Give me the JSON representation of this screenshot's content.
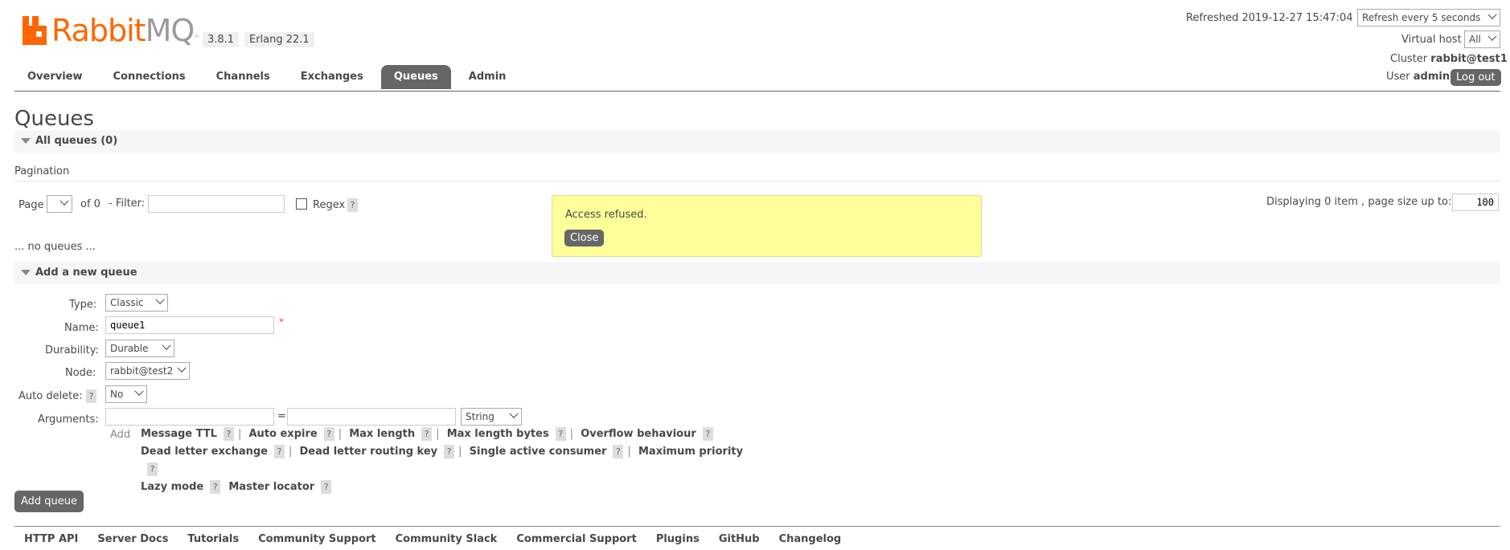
{
  "header": {
    "brand_main": "Rabbit",
    "brand_mq": "MQ",
    "brand_tm": "™",
    "version": "3.8.1",
    "erlang": "Erlang 22.1",
    "refreshed": "Refreshed 2019-12-27 15:47:04",
    "refresh_select": "Refresh every 5 seconds",
    "vhost_label": "Virtual host",
    "vhost_select": "All",
    "cluster_label": "Cluster",
    "cluster_value": "rabbit@test1",
    "user_label": "User",
    "user_value": "admin",
    "logout": "Log out"
  },
  "tabs": [
    "Overview",
    "Connections",
    "Channels",
    "Exchanges",
    "Queues",
    "Admin"
  ],
  "page_title": "Queues",
  "all_queues": {
    "header": "All queues (0)",
    "pagination_label": "Pagination",
    "page_label": "Page",
    "of_label": "of 0",
    "filter_label": "- Filter:",
    "regex_label": "Regex",
    "help": "?",
    "displaying": "Displaying 0 item , page size up to:",
    "page_size": "100",
    "empty": "... no queues ..."
  },
  "alert": {
    "message": "Access refused.",
    "close": "Close"
  },
  "add_queue": {
    "header": "Add a new queue",
    "type_label": "Type:",
    "type_value": "Classic",
    "name_label": "Name:",
    "name_value": "queue1",
    "required_mark": "*",
    "durability_label": "Durability:",
    "durability_value": "Durable",
    "node_label": "Node:",
    "node_value": "rabbit@test2",
    "autodelete_label": "Auto delete:",
    "autodelete_value": "No",
    "arguments_label": "Arguments:",
    "equals": "=",
    "arg_type": "String",
    "add_label": "Add",
    "submit": "Add queue",
    "arg_links": [
      "Message TTL",
      "Auto expire",
      "Max length",
      "Max length bytes",
      "Overflow behaviour",
      "Dead letter exchange",
      "Dead letter routing key",
      "Single active consumer",
      "Maximum priority",
      "Lazy mode",
      "Master locator"
    ]
  },
  "footer": [
    "HTTP API",
    "Server Docs",
    "Tutorials",
    "Community Support",
    "Community Slack",
    "Commercial Support",
    "Plugins",
    "GitHub",
    "Changelog"
  ],
  "colors": {
    "brand_orange": "#ff6600",
    "tab_active_bg": "#666666",
    "alert_bg": "#ffff99"
  }
}
